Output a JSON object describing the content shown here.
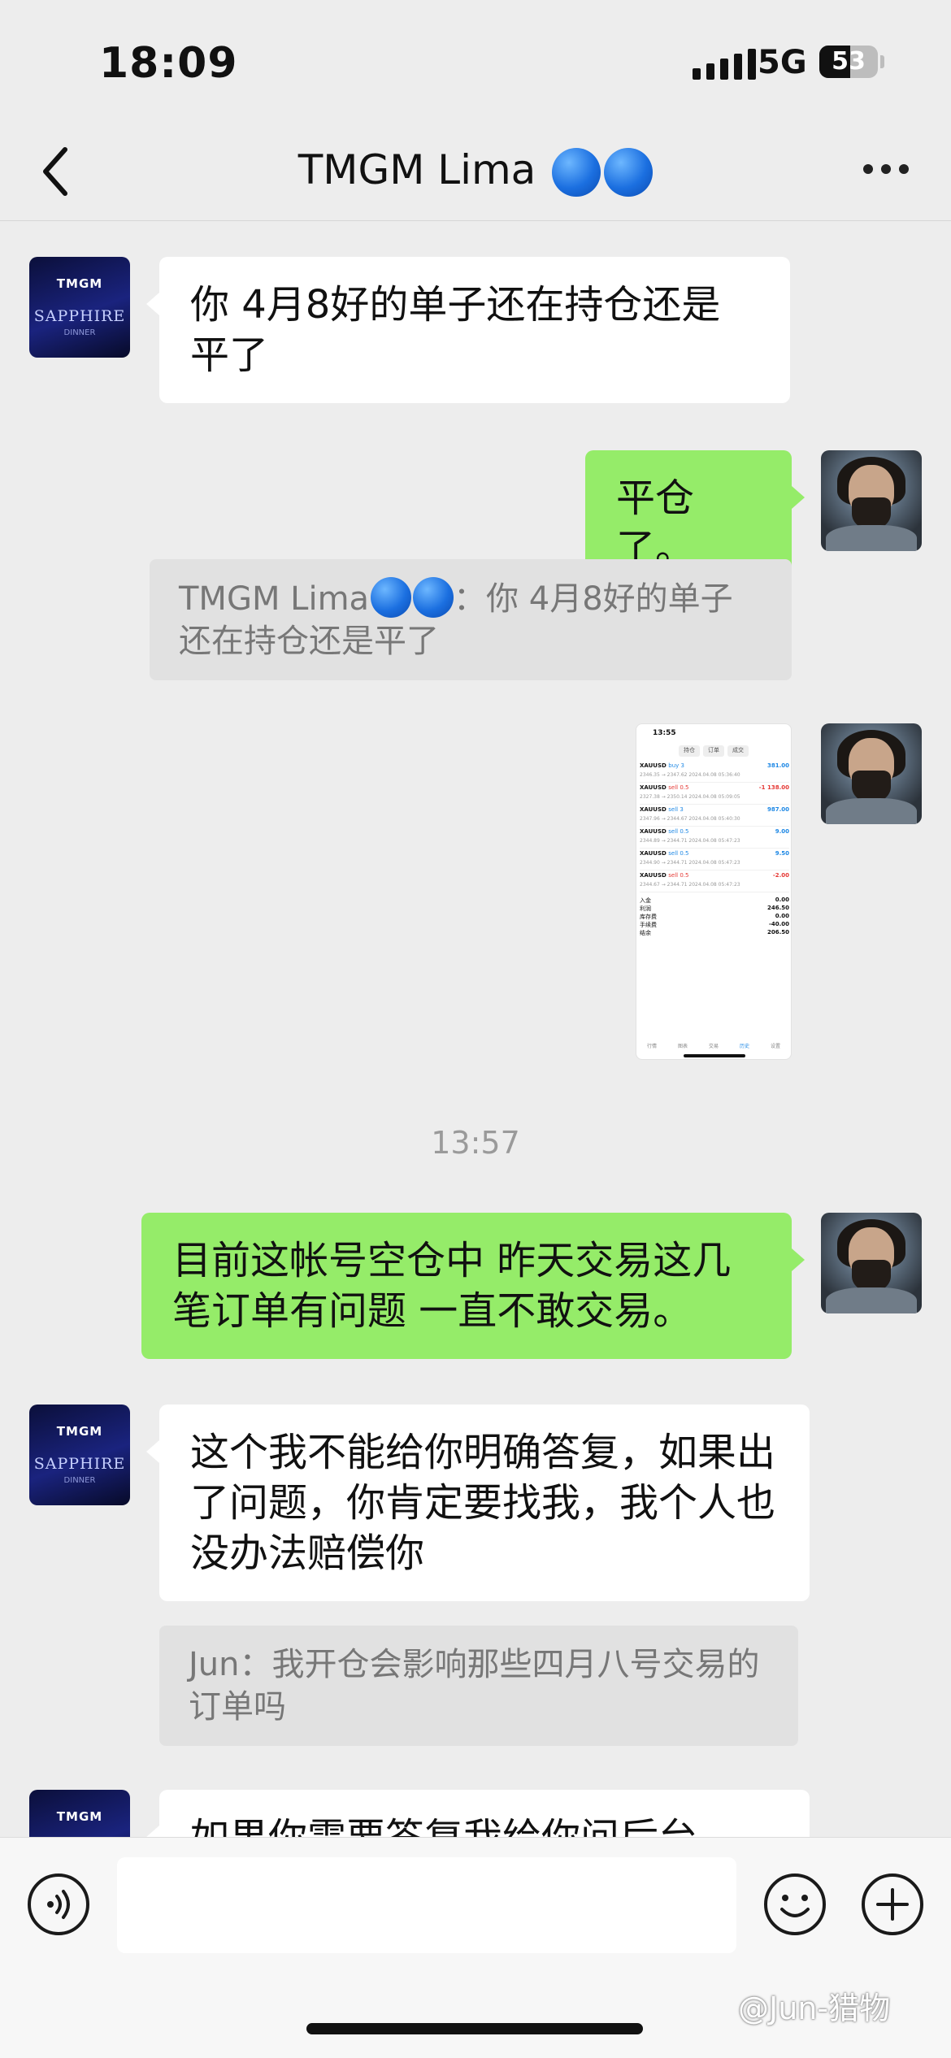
{
  "status": {
    "time": "18:09",
    "network": "5G",
    "battery": "53",
    "battery_level": 0.53
  },
  "nav": {
    "title": "TMGM Lima"
  },
  "avatars": {
    "contact_logo": "TMGM",
    "contact_word": "SAPPHIRE",
    "contact_sub": "DINNER"
  },
  "messages": {
    "m1": "你 4月8好的单子还在持仓还是平了",
    "m2": "平仓了。",
    "q1_prefix": "TMGM Lima",
    "q1_text": "：你 4月8好的单子还在持仓还是平了",
    "ts": "13:57",
    "m3": "目前这帐号空仓中  昨天交易这几笔订单有问题  一直不敢交易。",
    "m4": "这个我不能给你明确答复，如果出了问题，你肯定要找我，我个人也没办法赔偿你",
    "q2": "Jun：我开仓会影响那些四月八号交易的订单吗",
    "m5": "如果你需要答复我给你问后台"
  },
  "screenshot": {
    "time": "13:55",
    "tabs": [
      "持仓",
      "订单",
      "成交"
    ],
    "rows": [
      {
        "symbol": "XAUUSD",
        "side": "buy 3",
        "pl": "381.00",
        "detail": "2346.35 → 2347.62   2024.04.08 05:36:40",
        "color": "#1e88e5"
      },
      {
        "symbol": "XAUUSD",
        "side": "sell 0.5",
        "pl": "-1 138.00",
        "detail": "2327.38 → 2350.14   2024.04.08 05:09:05",
        "color": "#e53935"
      },
      {
        "symbol": "XAUUSD",
        "side": "sell 3",
        "pl": "987.00",
        "detail": "2347.96 → 2344.67   2024.04.08 05:40:30",
        "color": "#1e88e5"
      },
      {
        "symbol": "XAUUSD",
        "side": "sell 0.5",
        "pl": "9.00",
        "detail": "2344.89 → 2344.71   2024.04.08 05:47:23",
        "color": "#1e88e5"
      },
      {
        "symbol": "XAUUSD",
        "side": "sell 0.5",
        "pl": "9.50",
        "detail": "2344.90 → 2344.71   2024.04.08 05:47:23",
        "color": "#1e88e5"
      },
      {
        "symbol": "XAUUSD",
        "side": "sell 0.5",
        "pl": "-2.00",
        "detail": "2344.67 → 2344.71   2024.04.08 05:47:23",
        "color": "#e53935"
      }
    ],
    "summary": [
      {
        "k": "入金",
        "v": "0.00"
      },
      {
        "k": "利润",
        "v": "246.50"
      },
      {
        "k": "库存费",
        "v": "0.00"
      },
      {
        "k": "手续费",
        "v": "-40.00"
      },
      {
        "k": "结余",
        "v": "206.50"
      }
    ],
    "footer": [
      "行情",
      "图表",
      "交易",
      "历史",
      "设置"
    ]
  },
  "watermark": "@Jun-猎物",
  "icons": [
    "back-icon",
    "more-icon",
    "voice-icon",
    "emoji-icon",
    "plus-icon"
  ]
}
